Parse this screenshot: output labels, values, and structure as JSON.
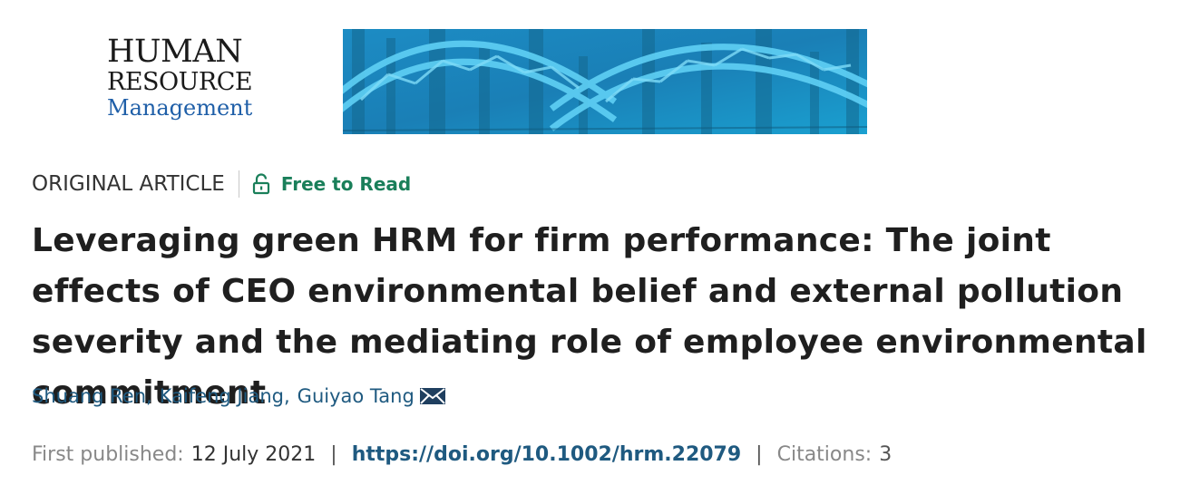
{
  "journal": {
    "line1": "HUMAN",
    "line2": "RESOURCE",
    "line3": "Management"
  },
  "article": {
    "type": "ORIGINAL ARTICLE",
    "access_label": "Free to Read",
    "title": "Leveraging green HRM for firm performance: The joint effects of CEO environmental belief and external pollution severity and the mediating role of employee environmental commitment",
    "authors": [
      "Shuang Ren",
      "Kaifeng Jiang",
      "Guiyao Tang"
    ],
    "author_separator": ",",
    "first_published_label": "First published:",
    "first_published_date": "12 July 2021",
    "divider": "|",
    "doi": "https://doi.org/10.1002/hrm.22079",
    "citations_label": "Citations:",
    "citations_value": "3"
  },
  "colors": {
    "access_green": "#1a7f5a",
    "link_blue": "#1f5a80",
    "banner_blue": "#1e8fc6"
  },
  "icons": [
    "lock-open-icon",
    "envelope-icon"
  ]
}
